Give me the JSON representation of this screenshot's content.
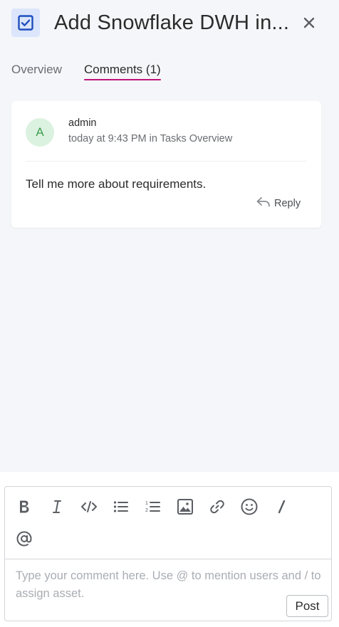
{
  "header": {
    "title": "Add Snowflake DWH in...",
    "task_icon": "checkbox-task-icon",
    "close_icon": "close-icon"
  },
  "tabs": [
    {
      "label": "Overview",
      "active": false
    },
    {
      "label": "Comments (1)",
      "active": true
    }
  ],
  "comment": {
    "avatar_letter": "A",
    "author": "admin",
    "meta": "today at 9:43 PM in Tasks Overview",
    "text": "Tell me more about requirements.",
    "reply_label": "Reply",
    "reply_icon": "reply-arrow-icon"
  },
  "editor": {
    "toolbar": [
      "bold-icon",
      "italic-icon",
      "code-icon",
      "bullet-list-icon",
      "numbered-list-icon",
      "image-icon",
      "link-icon",
      "emoji-icon",
      "slash-command-icon",
      "mention-icon"
    ],
    "placeholder": "Type your comment here. Use @ to mention users and / to assign asset.",
    "post_label": "Post"
  },
  "colors": {
    "accent_tab_underline": "#c0157b",
    "task_icon": "#1f4fbf",
    "avatar_bg": "#dcf2e0",
    "avatar_text": "#3d9d4f"
  }
}
